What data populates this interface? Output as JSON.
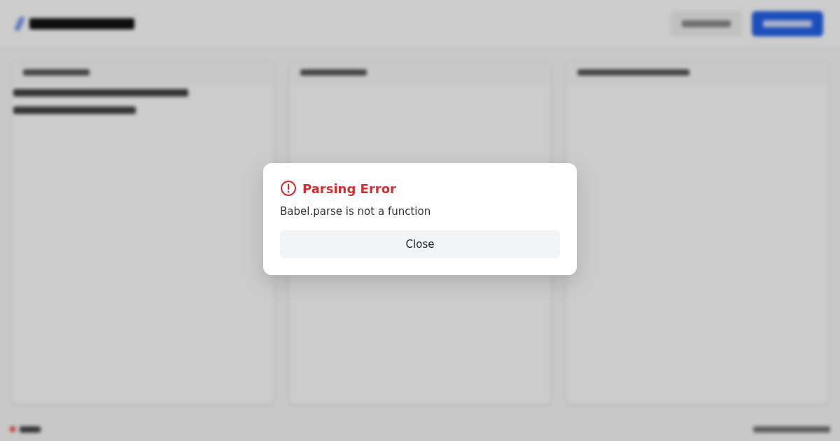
{
  "dialog": {
    "title": "Parsing Error",
    "message": "Babel.parse is not a function",
    "button": "Close"
  }
}
